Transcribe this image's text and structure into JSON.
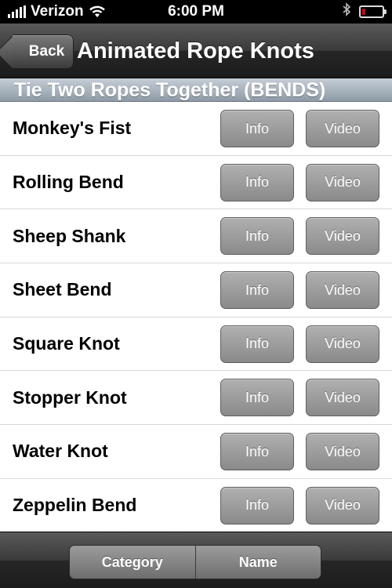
{
  "status_bar": {
    "carrier": "Verizon",
    "time": "6:00 PM",
    "battery_level": 0.18,
    "icons": [
      "signal-bars-icon",
      "wifi-icon",
      "bluetooth-icon",
      "battery-icon"
    ]
  },
  "nav": {
    "back_label": "Back",
    "title": "Animated Rope Knots"
  },
  "section": {
    "header": "Tie Two Ropes Together (BENDS)"
  },
  "rows": [
    {
      "label": "Monkey's Fist",
      "info": "Info",
      "video": "Video"
    },
    {
      "label": "Rolling Bend",
      "info": "Info",
      "video": "Video"
    },
    {
      "label": "Sheep Shank",
      "info": "Info",
      "video": "Video"
    },
    {
      "label": "Sheet Bend",
      "info": "Info",
      "video": "Video"
    },
    {
      "label": "Square Knot",
      "info": "Info",
      "video": "Video"
    },
    {
      "label": "Stopper Knot",
      "info": "Info",
      "video": "Video"
    },
    {
      "label": "Water Knot",
      "info": "Info",
      "video": "Video"
    },
    {
      "label": "Zeppelin Bend",
      "info": "Info",
      "video": "Video"
    }
  ],
  "toolbar": {
    "segments": [
      "Category",
      "Name"
    ]
  },
  "colors": {
    "battery_low": "#d0021b",
    "section_header": "#a9b4be"
  }
}
